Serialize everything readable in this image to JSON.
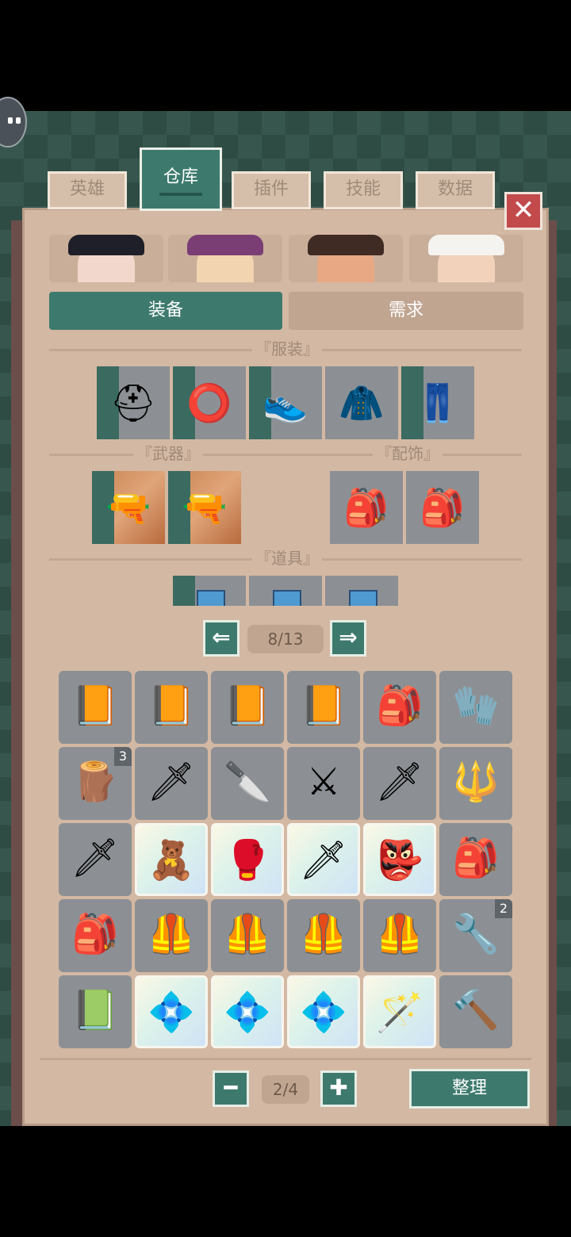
{
  "tabs": [
    "英雄",
    "仓库",
    "插件",
    "技能",
    "数据"
  ],
  "active_tab": 1,
  "close_icon": "close-icon",
  "heroes": [
    {
      "name": "hero-black-hair",
      "skin": "#f2d7cc",
      "hair": "#1e1f28"
    },
    {
      "name": "hero-witch",
      "skin": "#f3d4b0",
      "hair": "#7a3d74"
    },
    {
      "name": "hero-buzzcut",
      "skin": "#e8a884",
      "hair": "#3f2a24"
    },
    {
      "name": "hero-white-hat",
      "skin": "#f3d2bc",
      "hair": "#f5f3ef"
    }
  ],
  "segments": {
    "equip": "装备",
    "needs": "需求"
  },
  "sections": {
    "clothing": "『服装』",
    "weapons": "『武器』",
    "accessories": "『配饰』",
    "items": "『道具』"
  },
  "equip_slots": {
    "clothing": [
      {
        "icon": "helmet-icon",
        "glyph": "⛑"
      },
      {
        "icon": "ring-icon",
        "glyph": "⭕"
      },
      {
        "icon": "shoes-icon",
        "glyph": "👟"
      },
      {
        "icon": "jacket-icon",
        "glyph": "🧥"
      },
      {
        "icon": "pants-icon",
        "glyph": "👖"
      }
    ],
    "weapons": [
      {
        "icon": "rifle-icon",
        "glyph": "🔫"
      },
      {
        "icon": "rifle-icon",
        "glyph": "🔫"
      }
    ],
    "accessories": [
      {
        "icon": "backpack-icon",
        "glyph": "🎒"
      },
      {
        "icon": "backpack-icon",
        "glyph": "🎒"
      }
    ]
  },
  "equip_pager": {
    "label": "8/13",
    "prev_icon": "arrow-left-icon",
    "next_icon": "arrow-right-icon"
  },
  "inventory": [
    {
      "icon": "book-icon",
      "glyph": "📙",
      "rare": false,
      "count": ""
    },
    {
      "icon": "book-icon",
      "glyph": "📙",
      "rare": false,
      "count": ""
    },
    {
      "icon": "book-icon",
      "glyph": "📙",
      "rare": false,
      "count": ""
    },
    {
      "icon": "book-icon",
      "glyph": "📙",
      "rare": false,
      "count": ""
    },
    {
      "icon": "green-backpack-icon",
      "glyph": "🎒",
      "rare": false,
      "count": ""
    },
    {
      "icon": "gloves-icon",
      "glyph": "🧤",
      "rare": false,
      "count": ""
    },
    {
      "icon": "wood-plank-icon",
      "glyph": "🪵",
      "rare": false,
      "count": "3"
    },
    {
      "icon": "spear-icon",
      "glyph": "🗡",
      "rare": false,
      "count": ""
    },
    {
      "icon": "dagger-icon",
      "glyph": "🔪",
      "rare": false,
      "count": ""
    },
    {
      "icon": "black-sword-icon",
      "glyph": "⚔",
      "rare": false,
      "count": ""
    },
    {
      "icon": "wooden-sword-icon",
      "glyph": "🗡",
      "rare": false,
      "count": ""
    },
    {
      "icon": "ornate-spear-icon",
      "glyph": "🔱",
      "rare": false,
      "count": ""
    },
    {
      "icon": "wooden-sword-icon",
      "glyph": "🗡",
      "rare": false,
      "count": ""
    },
    {
      "icon": "teddy-bear-icon",
      "glyph": "🧸",
      "rare": true,
      "count": ""
    },
    {
      "icon": "gauntlet-icon",
      "glyph": "🥊",
      "rare": true,
      "count": ""
    },
    {
      "icon": "red-blade-icon",
      "glyph": "🗡",
      "rare": true,
      "count": ""
    },
    {
      "icon": "mask-icon",
      "glyph": "👺",
      "rare": true,
      "count": ""
    },
    {
      "icon": "backpack-icon",
      "glyph": "🎒",
      "rare": false,
      "count": ""
    },
    {
      "icon": "backpack-icon",
      "glyph": "🎒",
      "rare": false,
      "count": ""
    },
    {
      "icon": "armor-vest-icon",
      "glyph": "🦺",
      "rare": false,
      "count": ""
    },
    {
      "icon": "armor-vest-icon",
      "glyph": "🦺",
      "rare": false,
      "count": ""
    },
    {
      "icon": "armor-vest-icon",
      "glyph": "🦺",
      "rare": false,
      "count": ""
    },
    {
      "icon": "armor-vest-icon",
      "glyph": "🦺",
      "rare": false,
      "count": ""
    },
    {
      "icon": "wrench-icon",
      "glyph": "🔧",
      "rare": false,
      "count": "2"
    },
    {
      "icon": "green-book-icon",
      "glyph": "📗",
      "rare": false,
      "count": ""
    },
    {
      "icon": "crystal-icon",
      "glyph": "💠",
      "rare": true,
      "count": ""
    },
    {
      "icon": "crystal-icon",
      "glyph": "💠",
      "rare": true,
      "count": ""
    },
    {
      "icon": "crystal-icon",
      "glyph": "💠",
      "rare": true,
      "count": ""
    },
    {
      "icon": "staff-icon",
      "glyph": "🪄",
      "rare": true,
      "count": ""
    },
    {
      "icon": "hammer-icon",
      "glyph": "🔨",
      "rare": false,
      "count": ""
    }
  ],
  "inventory_pager": {
    "label": "2/4",
    "minus_icon": "minus-icon",
    "plus_icon": "plus-icon"
  },
  "sort_label": "整理",
  "colors": {
    "accent": "#3d7a6d",
    "panel": "#d3b8a3",
    "slot": "#8c9094",
    "close": "#c24a4a"
  }
}
